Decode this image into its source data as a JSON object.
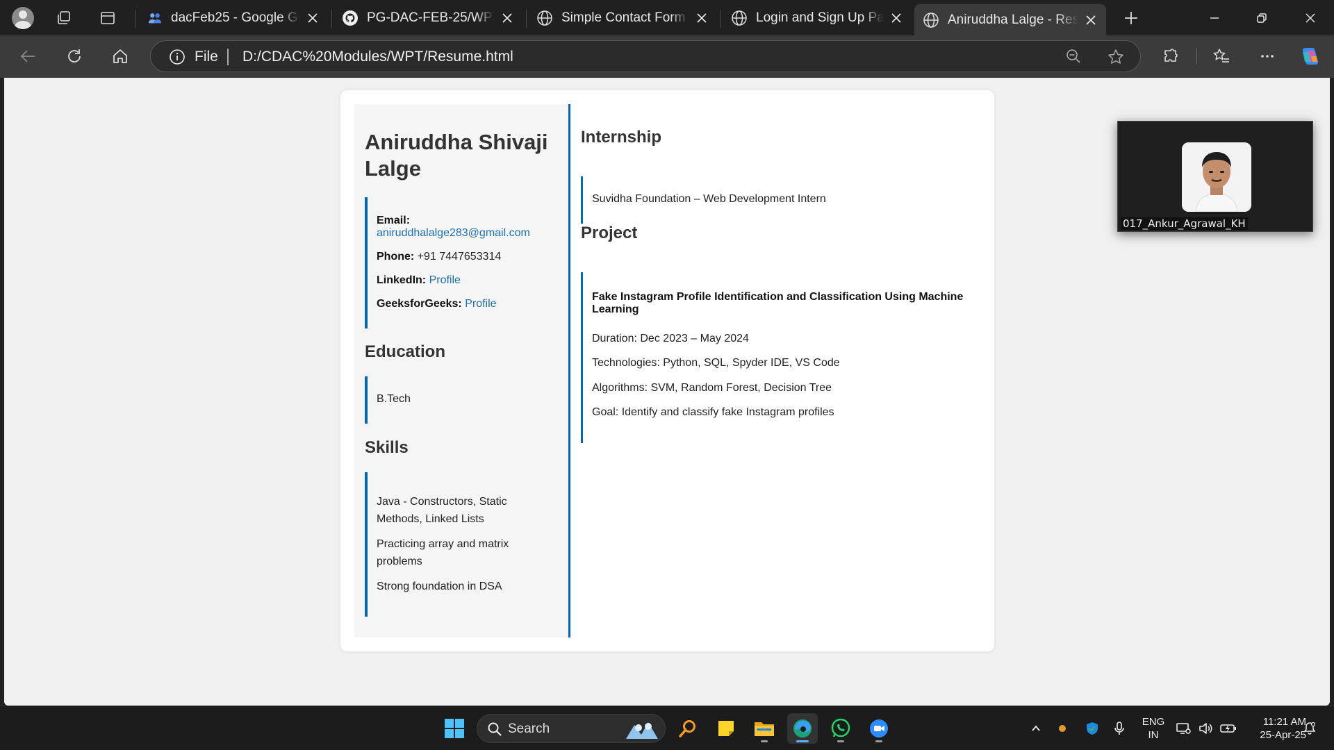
{
  "tabs": [
    {
      "title": "dacFeb25 - Google Groups",
      "icon": "google-groups-icon"
    },
    {
      "title": "PG-DAC-FEB-25/WPT/Practice",
      "icon": "github-icon"
    },
    {
      "title": "Simple Contact Form",
      "icon": "globe-icon"
    },
    {
      "title": "Login and Sign Up Page",
      "icon": "globe-icon"
    },
    {
      "title": "Aniruddha Lalge - Resume",
      "icon": "globe-icon",
      "active": true
    }
  ],
  "address_bar": {
    "scheme_label": "File",
    "url": "D:/CDAC%20Modules/WPT/Resume.html"
  },
  "resume": {
    "name": "Aniruddha Shivaji Lalge",
    "contact": {
      "email_label": "Email:",
      "email": "aniruddhalalge283@gmail.com",
      "phone_label": "Phone:",
      "phone": "+91 7447653314",
      "linkedin_label": "LinkedIn:",
      "linkedin_link": "Profile",
      "gfg_label": "GeeksforGeeks:",
      "gfg_link": "Profile"
    },
    "education_heading": "Education",
    "education": [
      "B.Tech"
    ],
    "skills_heading": "Skills",
    "skills": [
      "Java - Constructors, Static Methods, Linked Lists",
      "Practicing array and matrix problems",
      "Strong foundation in DSA"
    ],
    "internship_heading": "Internship",
    "internship": "Suvidha Foundation – Web Development Intern",
    "project_heading": "Project",
    "project": {
      "title": "Fake Instagram Profile Identification and Classification Using Machine Learning",
      "duration": "Duration: Dec 2023 – May 2024",
      "technologies": "Technologies: Python, SQL, Spyder IDE, VS Code",
      "algorithms": "Algorithms: SVM, Random Forest, Decision Tree",
      "goal": "Goal: Identify and classify fake Instagram profiles"
    }
  },
  "video_overlay": {
    "participant_name": "017_Ankur_Agrawal_KH"
  },
  "taskbar": {
    "search_label": "Search",
    "language": "ENG",
    "region": "IN",
    "time": "11:21 AM",
    "date": "25-Apr-25"
  },
  "colors": {
    "accent": "#0066bb",
    "link": "#1a6fb5",
    "background": "#f0f0f0"
  }
}
